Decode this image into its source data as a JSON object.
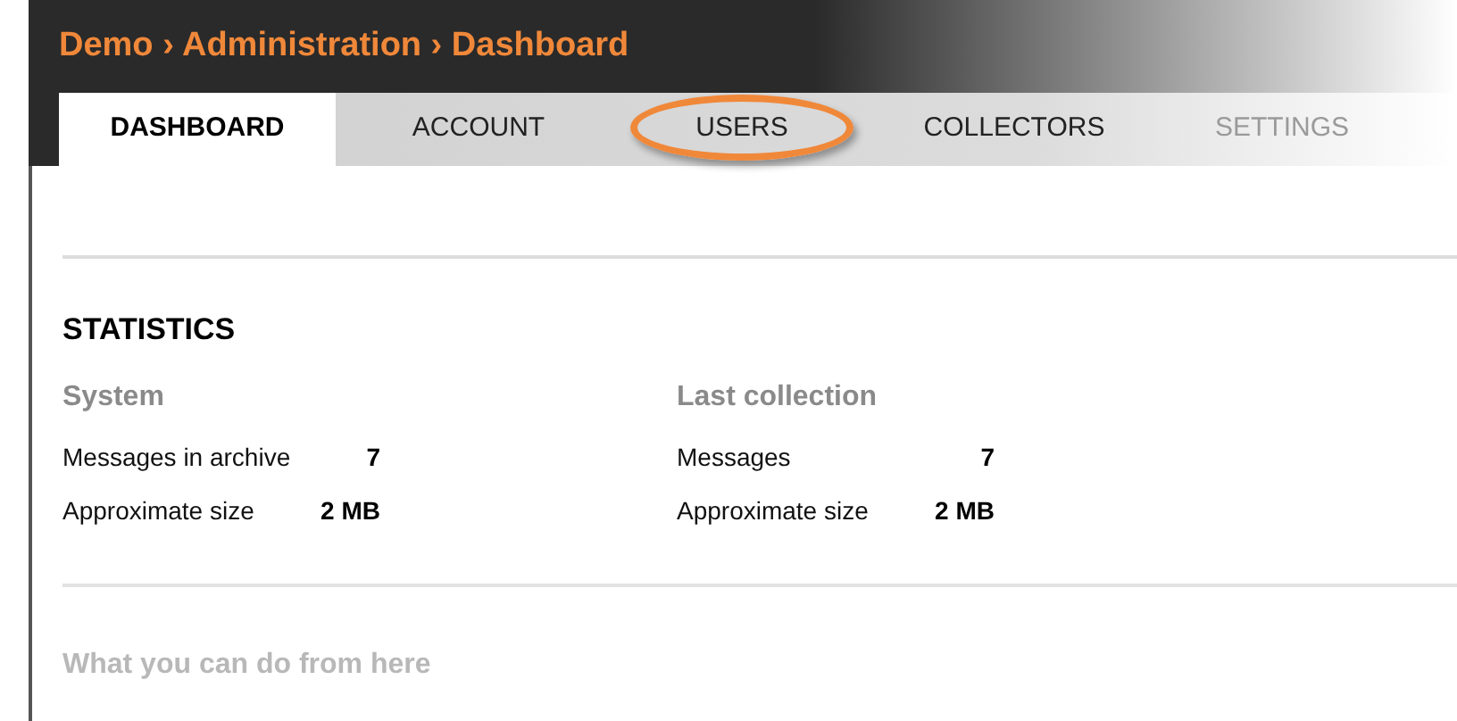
{
  "breadcrumb": "Demo › Administration › Dashboard",
  "tabs": [
    {
      "label": "DASHBOARD",
      "selected": true,
      "disabled": false,
      "highlighted": false
    },
    {
      "label": "ACCOUNT",
      "selected": false,
      "disabled": false,
      "highlighted": false
    },
    {
      "label": "USERS",
      "selected": false,
      "disabled": false,
      "highlighted": true
    },
    {
      "label": "COLLECTORS",
      "selected": false,
      "disabled": false,
      "highlighted": false
    },
    {
      "label": "SETTINGS",
      "selected": false,
      "disabled": true,
      "highlighted": false
    }
  ],
  "statistics": {
    "title": "STATISTICS",
    "groups": [
      {
        "title": "System",
        "rows": [
          {
            "label": "Messages in archive",
            "value": "7"
          },
          {
            "label": "Approximate size",
            "value": "2 MB"
          }
        ]
      },
      {
        "title": "Last collection",
        "rows": [
          {
            "label": "Messages",
            "value": "7"
          },
          {
            "label": "Approximate size",
            "value": "2 MB"
          }
        ]
      }
    ]
  },
  "next_section": {
    "title": "What you can do from here"
  }
}
